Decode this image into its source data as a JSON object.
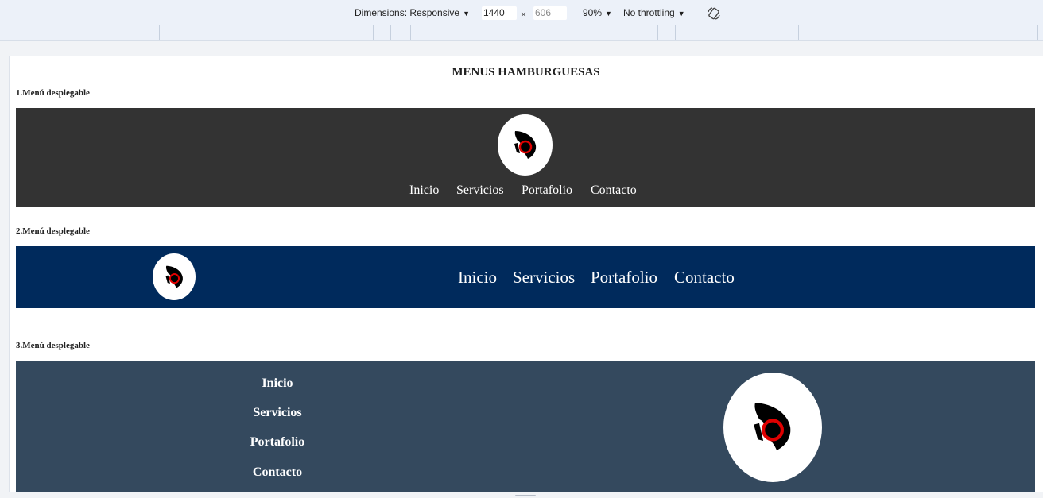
{
  "devtools": {
    "dimensions_label": "Dimensions: Responsive",
    "width_value": "1440",
    "times": "×",
    "height_placeholder": "606",
    "zoom": "90%",
    "throttling": "No throttling",
    "rotate_icon": "rotate-icon"
  },
  "page": {
    "title": "MENUS HAMBURGUESAS",
    "sections": [
      {
        "label": "1.Menú desplegable",
        "links": [
          "Inicio",
          "Servicios",
          "Portafolio",
          "Contacto"
        ],
        "bg": "#333333"
      },
      {
        "label": "2.Menú desplegable",
        "links": [
          "Inicio",
          "Servicios",
          "Portafolio",
          "Contacto"
        ],
        "bg": "#002a5c"
      },
      {
        "label": "3.Menú desplegable",
        "links": [
          "Inicio",
          "Servicios",
          "Portafolio",
          "Contacto"
        ],
        "bg": "#34495e"
      }
    ],
    "logo_icon": "eye-logo-icon",
    "accent": "#e00000"
  }
}
